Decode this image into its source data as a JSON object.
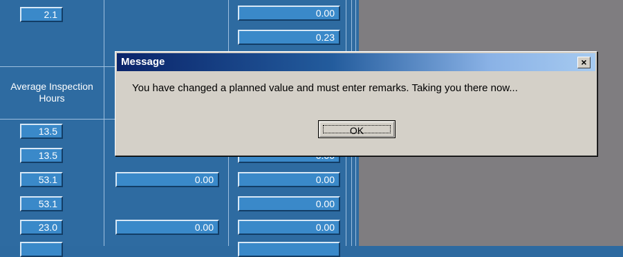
{
  "grid": {
    "header": "Average Inspection Hours",
    "col1": [
      "2.1",
      "13.5",
      "13.5",
      "53.1",
      "53.1",
      "23.0"
    ],
    "col2": [
      "0.00",
      "0.00"
    ],
    "col3": [
      "0.00",
      "0.23",
      "0.00",
      "0.00",
      "0.00",
      "0.00"
    ]
  },
  "dialog": {
    "title": "Message",
    "close_label": "×",
    "message": "You have changed a planned value and must enter remarks. Taking you there  now...",
    "ok_label": "OK"
  }
}
